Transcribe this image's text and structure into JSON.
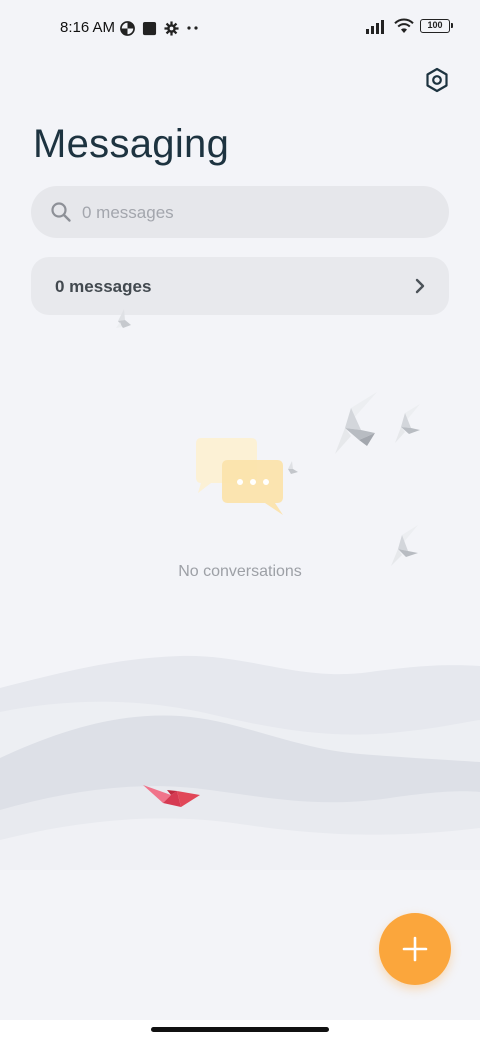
{
  "status_bar": {
    "time": "8:16 AM",
    "left_icons": [
      "data-saver-icon",
      "square-app-icon",
      "settings-gear-icon",
      "more-dots-icon"
    ],
    "right_icons": [
      "cellular-signal-icon",
      "wifi-icon",
      "battery-icon"
    ],
    "battery_level": "100"
  },
  "header": {
    "title": "Messaging",
    "settings_icon": "settings-hexagon-icon"
  },
  "search": {
    "placeholder": "0 messages"
  },
  "messages_row": {
    "label": "0 messages"
  },
  "empty_state": {
    "label": "No conversations"
  },
  "fab": {
    "icon": "plus-icon",
    "color": "#fba63c"
  },
  "colors": {
    "background": "#f3f4f8",
    "title": "#1d3340",
    "accent": "#fba63c",
    "boat": "#e14758"
  }
}
